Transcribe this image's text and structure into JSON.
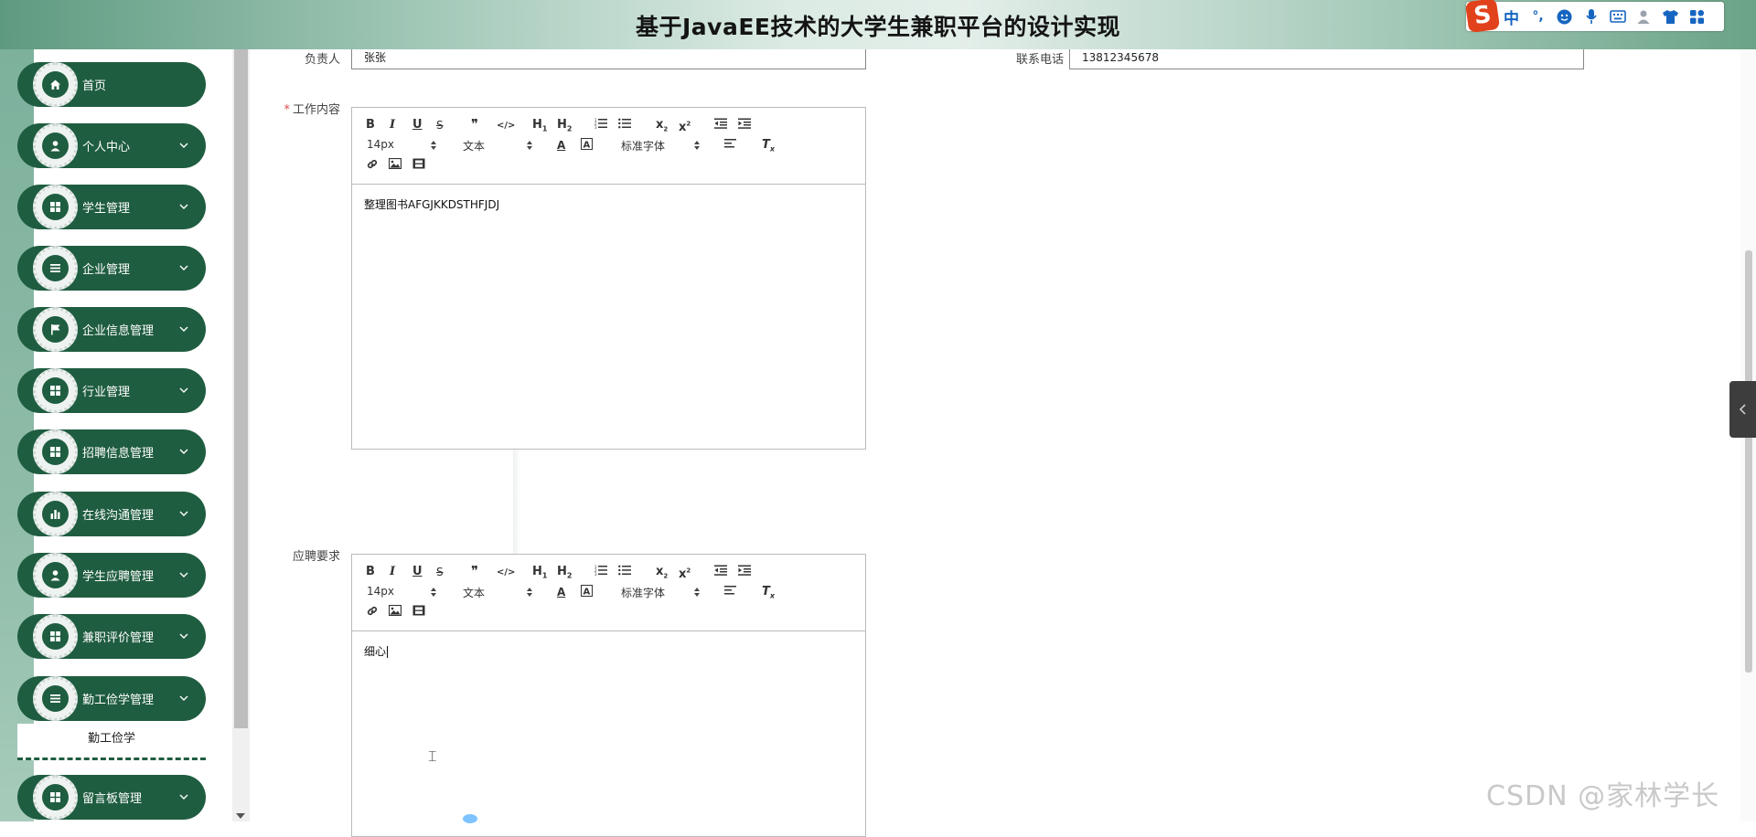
{
  "header": {
    "title": "基于JavaEE技术的大学生兼职平台的设计实现",
    "ime": {
      "logo": "S",
      "mode": "中",
      "punct": "°,",
      "icons": [
        "smiley-icon",
        "microphone-icon",
        "keyboard-icon",
        "user-icon",
        "tshirt-icon",
        "grid-icon"
      ]
    }
  },
  "sidebar": {
    "items": [
      {
        "label": "首页",
        "icon": "home-icon",
        "chevron": false
      },
      {
        "label": "个人中心",
        "icon": "user-icon",
        "chevron": true
      },
      {
        "label": "学生管理",
        "icon": "grid-icon",
        "chevron": true
      },
      {
        "label": "企业管理",
        "icon": "list-icon",
        "chevron": true
      },
      {
        "label": "企业信息管理",
        "icon": "flag-icon",
        "chevron": true
      },
      {
        "label": "行业管理",
        "icon": "grid-icon",
        "chevron": true
      },
      {
        "label": "招聘信息管理",
        "icon": "grid-icon",
        "chevron": true
      },
      {
        "label": "在线沟通管理",
        "icon": "bar-chart-icon",
        "chevron": true
      },
      {
        "label": "学生应聘管理",
        "icon": "user-icon",
        "chevron": true
      },
      {
        "label": "兼职评价管理",
        "icon": "grid-icon",
        "chevron": true
      },
      {
        "label": "勤工俭学管理",
        "icon": "list-icon",
        "chevron": true
      },
      {
        "label": "留言板管理",
        "icon": "grid-icon",
        "chevron": true
      }
    ],
    "submenu": {
      "label": "勤工俭学"
    }
  },
  "form": {
    "manager": {
      "label": "负责人",
      "value": "张张"
    },
    "phone": {
      "label": "联系电话",
      "value": "13812345678"
    },
    "work_content": {
      "label": "工作内容",
      "required": "*",
      "size": "14px",
      "format": "文本",
      "font": "标准字体",
      "content": "整理图书AFGJKKDSTHFJDJ"
    },
    "requirements": {
      "label": "应聘要求",
      "size": "14px",
      "format": "文本",
      "font": "标准字体",
      "content": "细心"
    }
  },
  "watermark": "CSDN @家林学长",
  "colors": {
    "sidebar_green": "#1f5d40",
    "required_red": "#e04a4a",
    "ime_blue": "#1565c0",
    "ime_logo": "#e2421b"
  }
}
